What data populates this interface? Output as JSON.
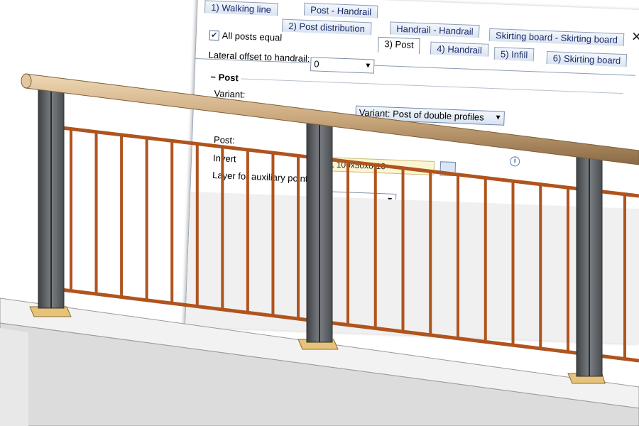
{
  "dialog": {
    "tabs_row1": [
      "1) Walking line",
      "Post - Handrail"
    ],
    "tabs_row2": [
      "2) Post distribution",
      "Handrail - Handrail",
      "Skirting board - Skirting board"
    ],
    "active_tab": "3) Post",
    "tabs_row3": [
      "4) Handrail",
      "5) Infill",
      "6) Skirting board"
    ],
    "close_glyph": "✕",
    "all_posts_equal": {
      "label": "All posts equal",
      "checked": true,
      "check_glyph": "✔"
    },
    "lateral_offset": {
      "label": "Lateral offset to handrail:",
      "value": "0"
    },
    "group_title": "Post",
    "variant_label": "Variant:",
    "variant_value": "Variant: Post of double profiles",
    "post_label": "Post:",
    "post_value": "… L 100x50x8-10",
    "invert_label": "Invert",
    "layer_label": "Layer for auxiliary points",
    "info_glyph": "i",
    "combo_arrow": "▼"
  },
  "scene": {
    "object": "3D railing model",
    "colors": {
      "handrail": "#c9a77c",
      "posts": "#5f6266",
      "bars": "#b0541e",
      "base_plates": "#e6c27a",
      "slab_top": "#f2f2f2",
      "slab_side": "#d9d9d9"
    }
  }
}
